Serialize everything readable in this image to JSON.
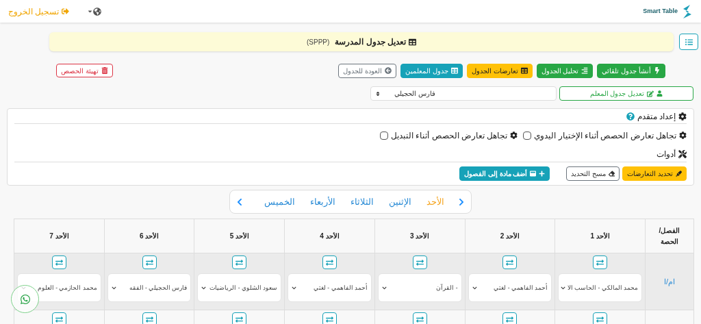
{
  "header": {
    "brand": "Smart Table",
    "logout": "تسجيل الخروج"
  },
  "banner": {
    "title": "تعديل جدول المدرسة",
    "code": "(SPPP)"
  },
  "toolbar": [
    {
      "label": "أنشأ جدول تلقائي",
      "kind": "auto"
    },
    {
      "label": "تحليل الجدول",
      "kind": "analyze"
    },
    {
      "label": "تعارضات الجدول",
      "kind": "conflicts"
    },
    {
      "label": "جدول المعلمين",
      "kind": "teachers"
    },
    {
      "label": "العودة للجدول",
      "kind": "back"
    }
  ],
  "reset_button": "تهيئة الحصص",
  "teacher_edit": {
    "button": "تعديل جدول المعلم",
    "value": "فارس الحجيلي"
  },
  "advanced": {
    "title": "إعداد متقدم",
    "options": [
      {
        "label": "تجاهل تعارض الحصص أثناء الإختيار اليدوي",
        "checked": false
      },
      {
        "label": "تجاهل تعارض الحصص أثناء التبديل",
        "checked": false
      }
    ],
    "tools_title": "أدوات",
    "tools": [
      {
        "label": "تحديد التعارضات",
        "kind": "highlight"
      },
      {
        "label": "مسح التحديد",
        "kind": "clear"
      },
      {
        "label": "أضف مادة إلى الفصول",
        "kind": "add"
      }
    ]
  },
  "days": [
    {
      "label": "الأحد",
      "selected": true
    },
    {
      "label": "الإثنين",
      "selected": false
    },
    {
      "label": "الثلاثاء",
      "selected": false
    },
    {
      "label": "الأربعاء",
      "selected": false
    },
    {
      "label": "الخميس",
      "selected": false
    }
  ],
  "table": {
    "corner": "الفصل/ الحصة",
    "columns": [
      "الأحد 1",
      "الأحد 2",
      "الأحد 3",
      "الأحد 4",
      "الأحد 5",
      "الأحد 6",
      "الأحد 7"
    ],
    "rows": [
      {
        "class": "ام/ا",
        "cells": [
          "محمد المالكي - الحاسب الا",
          "أحمد الفاهمي - لغتي",
          "- القرآن",
          "أحمد الفاهمي - لغتي",
          "سعود الشلوي - الرياضيات",
          "فارس الحجيلي - الفقه",
          "محمد الحازمي - العلوم"
        ]
      }
    ]
  }
}
